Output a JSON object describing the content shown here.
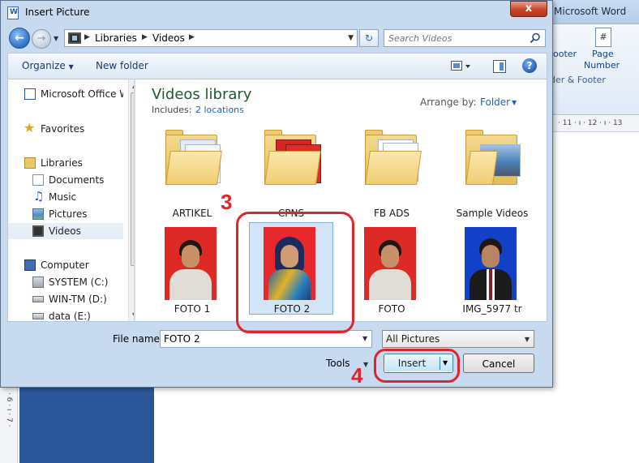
{
  "word": {
    "title": "Microsoft Word",
    "ribbon": {
      "footer": "ooter",
      "page_number_1": "Page",
      "page_number_2": "Number",
      "group": "der & Footer"
    },
    "ruler": "· 11 · ı · 12 · ı · 13",
    "vruler": "· 6 · ı · 7 ·"
  },
  "dialog": {
    "title": "Insert Picture",
    "close_label": "x"
  },
  "address": {
    "crumbs": [
      "Libraries",
      "Videos"
    ]
  },
  "search": {
    "placeholder": "Search Videos"
  },
  "toolbar": {
    "organize": "Organize",
    "new_folder": "New folder",
    "help": "?"
  },
  "nav": {
    "items": [
      {
        "label": "Microsoft Office W",
        "icon": "word-doc-icon"
      },
      {
        "label": "Favorites",
        "icon": "star-icon"
      },
      {
        "label": "Libraries",
        "icon": "libraries-icon"
      },
      {
        "label": "Documents",
        "icon": "documents-icon"
      },
      {
        "label": "Music",
        "icon": "music-icon"
      },
      {
        "label": "Pictures",
        "icon": "pictures-icon"
      },
      {
        "label": "Videos",
        "icon": "videos-icon"
      },
      {
        "label": "Computer",
        "icon": "computer-icon"
      },
      {
        "label": "SYSTEM (C:)",
        "icon": "drive-icon"
      },
      {
        "label": "WIN-TM (D:)",
        "icon": "drive-icon"
      },
      {
        "label": "data (E:)",
        "icon": "drive-icon"
      }
    ]
  },
  "library": {
    "title": "Videos library",
    "includes_label": "Includes:",
    "locations": "2 locations",
    "arrange_label": "Arrange by:",
    "arrange_value": "Folder"
  },
  "tiles": [
    {
      "label": "ARTIKEL",
      "kind": "folder"
    },
    {
      "label": "CPNS",
      "kind": "folder"
    },
    {
      "label": "FB ADS",
      "kind": "folder"
    },
    {
      "label": "Sample Videos",
      "kind": "folder"
    },
    {
      "label": "FOTO 1",
      "kind": "photo"
    },
    {
      "label": "FOTO 2",
      "kind": "photo"
    },
    {
      "label": "FOTO",
      "kind": "photo"
    },
    {
      "label": "IMG_5977 tr",
      "kind": "photo"
    }
  ],
  "bottom": {
    "filename_label": "File name:",
    "filename_value": "FOTO 2",
    "filetype_value": "All Pictures",
    "tools": "Tools",
    "insert": "Insert",
    "cancel": "Cancel"
  },
  "annotations": {
    "step3": "3",
    "step4": "4"
  },
  "colors": {
    "annotation": "#e0242c",
    "link": "#1e66b8",
    "library_title": "#1e5a2e"
  }
}
